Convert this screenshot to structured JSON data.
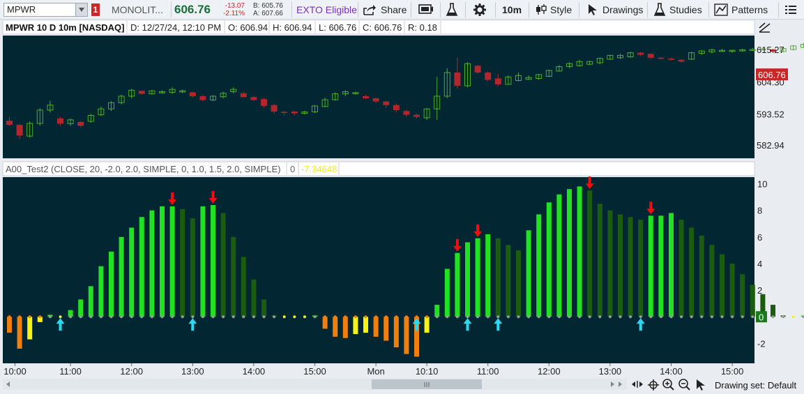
{
  "toolbar": {
    "symbol": "MPWR",
    "link_badge": "1",
    "company": "MONOLIT...",
    "last_price": "606.76",
    "change": "-13.07",
    "change_pct": "-2.11%",
    "bid": "B: 605.76",
    "ask": "A: 607.66",
    "exto": "EXTO Eligible",
    "share_label": "Share",
    "timeframe": "10m",
    "style_label": "Style",
    "drawings_label": "Drawings",
    "studies_label": "Studies",
    "patterns_label": "Patterns"
  },
  "price_header": {
    "title": "MPWR 10 D 10m [NASDAQ]",
    "date": "D: 12/27/24, 12:10 PM",
    "open": "O: 606.94",
    "high": "H: 606.94",
    "low": "L: 606.76",
    "close": "C: 606.76",
    "range": "R: 0.18"
  },
  "study_header": {
    "name": "A00_Test2 (CLOSE, 20, -2.0, 2.0, SIMPLE, 0, 1.0, 1.5, 2.0, SIMPLE)",
    "value0": "0",
    "value1": "-7.34648"
  },
  "footer": {
    "drawing_set": "Drawing set: Default"
  },
  "colors": {
    "background": "#022733",
    "up_candle": "#4caf2a",
    "down_candle": "#b3262c",
    "bright_green": "#22e022",
    "dark_green": "#1c5c10",
    "orange": "#f07f10",
    "yellow": "#f7f21a",
    "up_arrow": "#2ad8f0",
    "down_arrow": "#ee1010",
    "price_label": "#c62828",
    "zero_label": "#1c7a1c"
  },
  "chart_data": [
    {
      "type": "candlestick",
      "title": "MPWR 10 D 10m [NASDAQ]",
      "ylim": [
        578.5,
        620
      ],
      "yticks": [
        615.27,
        604.3,
        593.52,
        582.94
      ],
      "current_price_label": "606.76",
      "candles": [
        [
          591.2,
          589.8,
          592.5,
          589.5
        ],
        [
          589.8,
          586.2,
          590,
          585
        ],
        [
          586,
          590.3,
          591,
          585.5
        ],
        [
          590.3,
          594.8,
          595.5,
          589.5
        ],
        [
          594.8,
          596.5,
          598,
          594
        ],
        [
          592,
          590.2,
          592.5,
          589.5
        ],
        [
          590.2,
          591.5,
          592,
          589.5
        ],
        [
          590.8,
          589.5,
          591,
          589
        ],
        [
          591,
          593,
          593.5,
          590.5
        ],
        [
          593.2,
          595.2,
          596,
          592.8
        ],
        [
          595.2,
          597.3,
          597.8,
          594.5
        ],
        [
          597.3,
          599.5,
          600,
          596.8
        ],
        [
          599.5,
          601.5,
          602,
          598.8
        ],
        [
          601.3,
          600.3,
          601.5,
          600
        ],
        [
          600.3,
          601.3,
          601.5,
          600
        ],
        [
          601,
          601,
          601.5,
          600.3
        ],
        [
          600.8,
          601.8,
          602.5,
          600.3
        ],
        [
          601,
          601.3,
          601.8,
          600.5
        ],
        [
          600.8,
          599.5,
          601,
          599
        ],
        [
          599.5,
          598.2,
          600,
          597.8
        ],
        [
          598.2,
          599.5,
          599.8,
          597.8
        ],
        [
          599.3,
          600.5,
          601,
          598.8
        ],
        [
          601,
          601.8,
          602.5,
          600.5
        ],
        [
          600.5,
          599.2,
          601,
          599
        ],
        [
          599.2,
          598.2,
          599.5,
          597.8
        ],
        [
          598.5,
          596.2,
          599,
          595.5
        ],
        [
          596.5,
          594.3,
          597,
          593.5
        ],
        [
          594.2,
          594,
          594.5,
          593
        ],
        [
          594.3,
          593.7,
          594.5,
          593
        ],
        [
          593.7,
          594.2,
          594.5,
          593.3
        ],
        [
          594.2,
          596.2,
          596.5,
          593.8
        ],
        [
          596,
          598.3,
          599,
          595.8
        ],
        [
          598.3,
          600.3,
          600.8,
          598
        ],
        [
          600.3,
          601,
          601.5,
          599.5
        ],
        [
          600.5,
          600.7,
          601,
          600
        ],
        [
          599.5,
          598.8,
          600,
          598.5
        ],
        [
          598.8,
          597.7,
          599,
          597.2
        ],
        [
          597.7,
          596.5,
          598,
          595.5
        ],
        [
          596.5,
          594.8,
          597,
          594
        ],
        [
          594.5,
          593.2,
          595,
          592.5
        ],
        [
          593.2,
          592.5,
          593.5,
          592
        ],
        [
          592.2,
          595.2,
          595.5,
          591.5
        ],
        [
          595.2,
          599.5,
          606,
          591.5
        ],
        [
          599.5,
          607.5,
          609,
          598.8
        ],
        [
          607.5,
          603,
          612.5,
          602
        ],
        [
          603,
          610.5,
          611,
          602.5
        ],
        [
          609.8,
          607.5,
          610,
          607
        ],
        [
          607.5,
          605,
          608,
          604.5
        ],
        [
          605.5,
          603.5,
          607,
          602.8
        ],
        [
          603.5,
          606,
          606.5,
          603.5
        ],
        [
          604.8,
          606.5,
          607.5,
          604.5
        ],
        [
          605.2,
          605.8,
          606.5,
          605
        ],
        [
          605.5,
          606.8,
          607,
          605
        ],
        [
          606.2,
          608.2,
          608.5,
          606
        ],
        [
          608,
          609.5,
          610,
          607.8
        ],
        [
          609.5,
          610.5,
          611,
          609
        ],
        [
          609.8,
          611.2,
          611.8,
          609.5
        ],
        [
          610.3,
          611.2,
          611.5,
          610
        ],
        [
          610.8,
          612.3,
          612.5,
          610.3
        ],
        [
          612,
          613.3,
          613.5,
          611.8
        ],
        [
          612.5,
          613.3,
          613.8,
          612
        ],
        [
          612.8,
          614.2,
          614.5,
          612.5
        ],
        [
          614.2,
          613.5,
          614.5,
          613
        ],
        [
          613.8,
          612.5,
          614,
          612
        ],
        [
          612.5,
          612.2,
          612.8,
          611.8
        ],
        [
          612.2,
          611.8,
          612.5,
          611.5
        ],
        [
          611.8,
          611.2,
          612,
          610.8
        ],
        [
          612,
          614.2,
          614.5,
          611.8
        ],
        [
          614,
          614.8,
          615,
          613.5
        ],
        [
          614.5,
          615.2,
          615.5,
          614
        ],
        [
          614.8,
          615,
          615.5,
          614.5
        ],
        [
          614.8,
          615,
          615.2,
          614.2
        ],
        [
          614.8,
          615.2,
          615.5,
          614.5
        ],
        [
          615,
          615.3,
          615.8,
          614.8
        ],
        [
          615.3,
          615.5,
          615.8,
          615
        ],
        [
          615.3,
          614.6,
          615.5,
          614.3
        ],
        [
          614.6,
          615.6,
          616,
          614.3
        ],
        [
          615.3,
          616.5,
          616.8,
          615
        ],
        [
          616,
          617,
          617.5,
          615.8
        ],
        [
          616.5,
          617.5,
          618,
          616.2
        ],
        [
          617.3,
          617.8,
          618.2,
          617
        ],
        [
          617,
          615.3,
          617.5,
          614.8
        ],
        [
          615.5,
          614.5,
          616,
          614
        ],
        [
          615.2,
          614.5,
          615.5,
          614
        ],
        [
          614.8,
          614.2,
          615,
          614
        ],
        [
          614,
          612.8,
          614.2,
          612.5
        ],
        [
          613.2,
          613.5,
          613.8,
          612.8
        ],
        [
          613,
          613.8,
          614.2,
          612.8
        ],
        [
          613.5,
          615.2,
          615.8,
          613
        ]
      ]
    },
    {
      "type": "bar",
      "title": "A00_Test2 (CLOSE, 20, -2.0, 2.0, SIMPLE, 0, 1.0, 1.5, 2.0, SIMPLE)",
      "ylim": [
        -3.5,
        10.5
      ],
      "yticks": [
        10,
        8,
        6,
        4,
        2,
        0,
        -2
      ],
      "categories": [
        "10:00",
        "11:00",
        "12:00",
        "13:00",
        "14:00",
        "15:00",
        "Mon",
        "10:10",
        "11:00",
        "12:00",
        "13:00",
        "14:00",
        "15:00"
      ],
      "values": [
        -1.2,
        -2.4,
        -1.7,
        -0.4,
        0.15,
        0,
        0.5,
        1.3,
        2.3,
        3.8,
        4.9,
        6.0,
        6.7,
        7.5,
        8.0,
        8.3,
        8.3,
        8.1,
        7.4,
        8.3,
        8.4,
        7.8,
        6.0,
        4.5,
        2.8,
        1.3,
        0.1,
        0,
        0,
        0,
        0.1,
        -0.9,
        -1.5,
        -1.6,
        -1.3,
        -1.2,
        -1.5,
        -1.8,
        -2.3,
        -2.8,
        -3.0,
        -1.2,
        0.9,
        3.6,
        4.8,
        5.6,
        5.9,
        6.2,
        5.9,
        5.4,
        5.0,
        6.5,
        7.7,
        8.6,
        9.2,
        9.6,
        9.8,
        9.5,
        8.5,
        8.0,
        7.7,
        7.5,
        7.3,
        7.6,
        7.6,
        7.8,
        7.3,
        6.7,
        6.1,
        5.4,
        4.7,
        4.0,
        3.2,
        2.4,
        1.7,
        0.9,
        0.1,
        0,
        0.1
      ],
      "up_arrows": [
        5,
        18,
        40,
        45,
        48,
        62
      ],
      "down_arrows": [
        16,
        20,
        44,
        46,
        57,
        63
      ]
    }
  ]
}
